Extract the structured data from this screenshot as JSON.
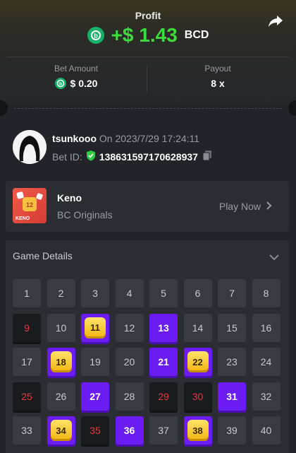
{
  "header": {
    "profit_label": "Profit",
    "profit_value": "+$ 1.43",
    "profit_currency": "BCD",
    "coin_icon": "bcd-coin-icon",
    "share_icon": "share-icon"
  },
  "stats": {
    "bet_amount_label": "Bet Amount",
    "bet_amount_value": "$ 0.20",
    "payout_label": "Payout",
    "payout_value": "8 x"
  },
  "bet": {
    "username": "tsunkooo",
    "on_text": "On 2023/7/29 17:24:11",
    "bet_id_label": "Bet ID:",
    "bet_id": "138631597170628937"
  },
  "game": {
    "name": "Keno",
    "provider": "BC Originals",
    "play_now": "Play Now",
    "thumb_text": "KENO",
    "thumb_num": "12"
  },
  "details": {
    "title": "Game Details",
    "cells": [
      {
        "n": "1",
        "s": "n"
      },
      {
        "n": "2",
        "s": "n"
      },
      {
        "n": "3",
        "s": "n"
      },
      {
        "n": "4",
        "s": "n"
      },
      {
        "n": "5",
        "s": "n"
      },
      {
        "n": "6",
        "s": "n"
      },
      {
        "n": "7",
        "s": "n"
      },
      {
        "n": "8",
        "s": "n"
      },
      {
        "n": "9",
        "s": "m"
      },
      {
        "n": "10",
        "s": "n"
      },
      {
        "n": "11",
        "s": "h"
      },
      {
        "n": "12",
        "s": "n"
      },
      {
        "n": "13",
        "s": "p"
      },
      {
        "n": "14",
        "s": "n"
      },
      {
        "n": "15",
        "s": "n"
      },
      {
        "n": "16",
        "s": "n"
      },
      {
        "n": "17",
        "s": "n"
      },
      {
        "n": "18",
        "s": "h"
      },
      {
        "n": "19",
        "s": "n"
      },
      {
        "n": "20",
        "s": "n"
      },
      {
        "n": "21",
        "s": "p"
      },
      {
        "n": "22",
        "s": "h"
      },
      {
        "n": "23",
        "s": "n"
      },
      {
        "n": "24",
        "s": "n"
      },
      {
        "n": "25",
        "s": "m"
      },
      {
        "n": "26",
        "s": "n"
      },
      {
        "n": "27",
        "s": "p"
      },
      {
        "n": "28",
        "s": "n"
      },
      {
        "n": "29",
        "s": "m"
      },
      {
        "n": "30",
        "s": "m"
      },
      {
        "n": "31",
        "s": "p"
      },
      {
        "n": "32",
        "s": "n"
      },
      {
        "n": "33",
        "s": "n"
      },
      {
        "n": "34",
        "s": "h"
      },
      {
        "n": "35",
        "s": "m"
      },
      {
        "n": "36",
        "s": "p"
      },
      {
        "n": "37",
        "s": "n"
      },
      {
        "n": "38",
        "s": "h"
      },
      {
        "n": "39",
        "s": "n"
      },
      {
        "n": "40",
        "s": "n"
      }
    ]
  },
  "colors": {
    "profit_green": "#3ddc3d",
    "pick_purple": "#6a1cf2",
    "miss_red": "#e23b3b",
    "gem_gold": "#f1b40e"
  }
}
